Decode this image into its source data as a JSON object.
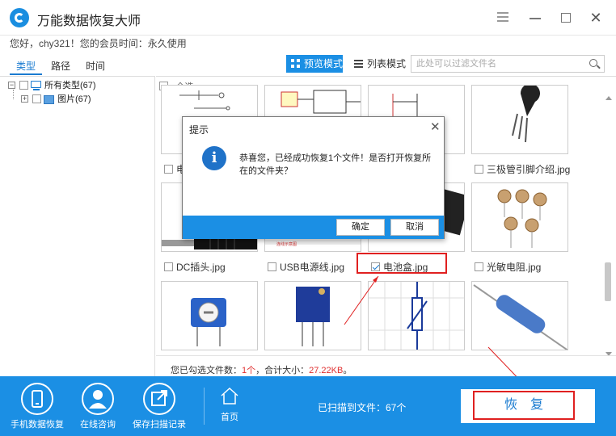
{
  "app": {
    "title": "万能数据恢复大师"
  },
  "member_info": "您好，chy321！您的会员时间：永久使用",
  "tabs": [
    {
      "label": "类型",
      "active": true
    },
    {
      "label": "路径",
      "active": false
    },
    {
      "label": "时间",
      "active": false
    }
  ],
  "view_modes": {
    "preview_label": "预览模式",
    "list_label": "列表模式",
    "active": "preview"
  },
  "search": {
    "placeholder": "此处可以过滤文件名",
    "value": ""
  },
  "tree": {
    "root": {
      "label": "所有类型(67)"
    },
    "child": {
      "label": "图片(67)"
    }
  },
  "grid": {
    "select_all_label": "▾全选",
    "row_labels": [
      {
        "label": "电",
        "checked": false
      },
      {
        "label": "三极管引脚介绍.jpg",
        "checked": false
      },
      {
        "label": "DC插头.jpg",
        "checked": false
      },
      {
        "label": "USB电源线.jpg",
        "checked": false
      },
      {
        "label": "电池盒.jpg",
        "checked": true
      },
      {
        "label": "光敏电阻.jpg",
        "checked": false
      }
    ],
    "thumbnail_icons": [
      "circuit-diagram-thumbnail",
      "schematic-thumbnail",
      "schematic-thumbnail",
      "transistor-thumbnail",
      "dc-plug-thumbnail",
      "usb-cable-thumbnail",
      "battery-box-thumbnail",
      "photoresistor-thumbnail",
      "trimmer-pot-thumbnail",
      "blue-potentiometer-thumbnail",
      "variable-resistor-symbol-thumbnail",
      "resistor-thumbnail"
    ]
  },
  "status": {
    "prefix": "您已勾选文件数：",
    "count": "1个",
    "middle": "，合计大小：",
    "size": "27.22KB",
    "suffix": "。"
  },
  "dialog": {
    "title": "提示",
    "message": "恭喜您，已经成功恢复1个文件！是否打开恢复所在的文件夹？",
    "ok_label": "确定",
    "cancel_label": "取消"
  },
  "bottom": {
    "items": [
      {
        "label": "手机数据恢复",
        "icon": "phone-icon"
      },
      {
        "label": "在线咨询",
        "icon": "user-support-icon"
      },
      {
        "label": "保存扫描记录",
        "icon": "save-export-icon"
      }
    ],
    "home_label": "首页",
    "scanned_text": "已扫描到文件：67个",
    "restore_label": "恢复"
  },
  "colors": {
    "accent": "#1b8fe4",
    "annotation": "#e02020",
    "highlight_text": "#e03030"
  }
}
